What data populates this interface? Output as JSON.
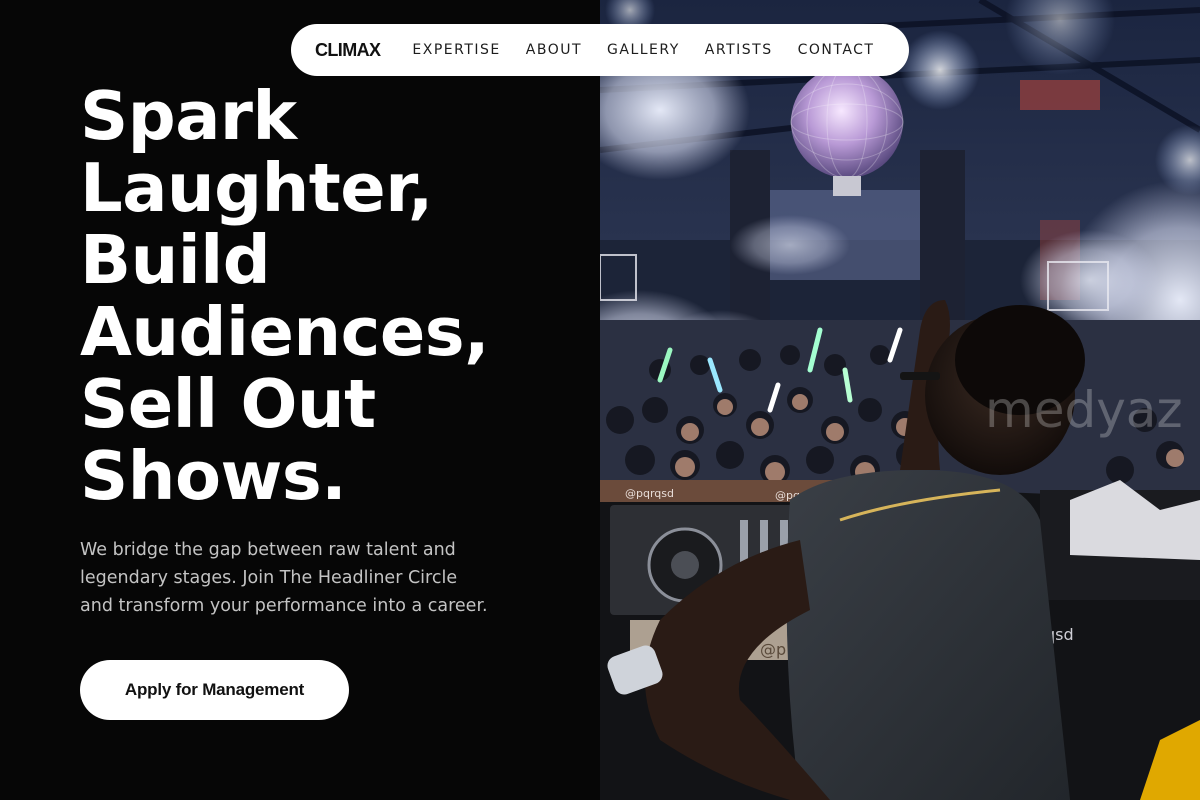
{
  "nav": {
    "brand": "CLIMAX",
    "links": [
      "EXPERTISE",
      "ABOUT",
      "GALLERY",
      "ARTISTS",
      "CONTACT"
    ]
  },
  "hero": {
    "title_lines": [
      "Spark",
      "Laughter,",
      "Build",
      "Audiences,",
      "Sell Out",
      "Shows."
    ],
    "description_lines": [
      "We bridge the gap between raw talent and",
      "legendary stages. Join The Headliner Circle",
      "and transform your performance into a career."
    ],
    "cta_label": "Apply for Management"
  },
  "photo": {
    "subject": "dj-performing-to-crowd",
    "deck_labels": [
      "@pqrqsd",
      "@pqrqsd",
      "@p",
      "qsd"
    ],
    "watermark": "medyaz"
  },
  "colors": {
    "background": "#060606",
    "nav_background": "#ffffff",
    "text_primary": "#ffffff",
    "text_secondary": "#c3c3c3",
    "button_background": "#ffffff",
    "button_text": "#111111"
  }
}
